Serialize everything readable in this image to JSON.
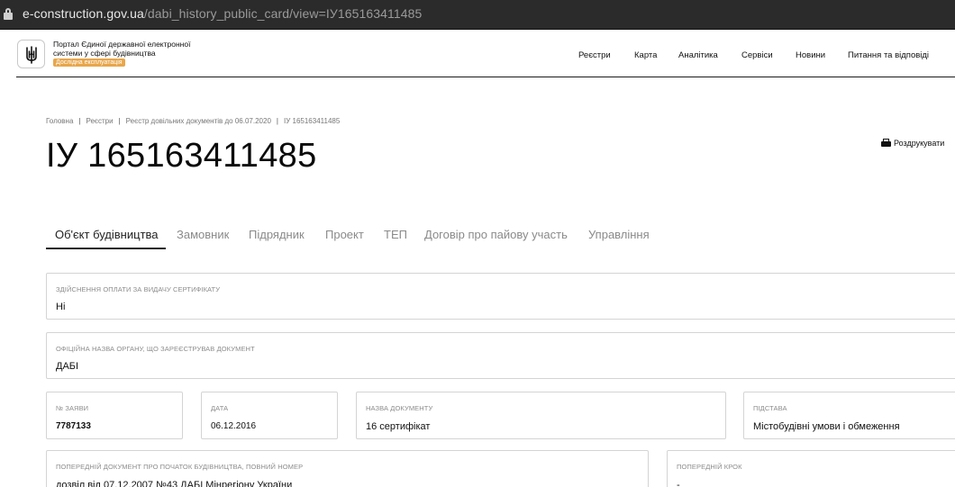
{
  "browser": {
    "url_host": "e-construction.gov.ua",
    "url_path": "/dabi_history_public_card/view=ІУ165163411485"
  },
  "header": {
    "portal_title": "Портал Єдиної державної електронної системи у сфері будівництва",
    "badge": "Дослідна експлуатація",
    "nav": [
      "Реєстри",
      "Карта",
      "Аналітика",
      "Сервіси",
      "Новини",
      "Питання та відповіді"
    ]
  },
  "breadcrumb": [
    "Головна",
    "Реєстри",
    "Реєстр довільних документів до 06.07.2020",
    "ІУ 165163411485"
  ],
  "page": {
    "title": "ІУ 165163411485",
    "print_label": "Роздрукувати"
  },
  "tabs": [
    "Об'єкт будівництва",
    "Замовник",
    "Підрядник",
    "Проект",
    "ТЕП",
    "Договір про пайову участь",
    "Управління"
  ],
  "fields": {
    "payment": {
      "label": "Здійснення оплати за видачу сертифікату",
      "value": "Ні"
    },
    "authority": {
      "label": "Офіційна назва органу, що зареєстрував документ",
      "value": "ДАБІ"
    },
    "app_number": {
      "label": "№ заяви",
      "value": "7787133"
    },
    "date": {
      "label": "Дата",
      "value": "06.12.2016"
    },
    "doc_name": {
      "label": "Назва документу",
      "value": "16 сертифікат"
    },
    "basis": {
      "label": "Підстава",
      "value": "Містобудівні умови і обмеження"
    },
    "prev_doc": {
      "label": "Попередній документ про початок будівництва, повний номер",
      "value": "дозвіл від 07.12.2007 №43 ДАБІ Мінрегіону України"
    },
    "prev_step": {
      "label": "Попередній крок",
      "value": "-"
    }
  }
}
